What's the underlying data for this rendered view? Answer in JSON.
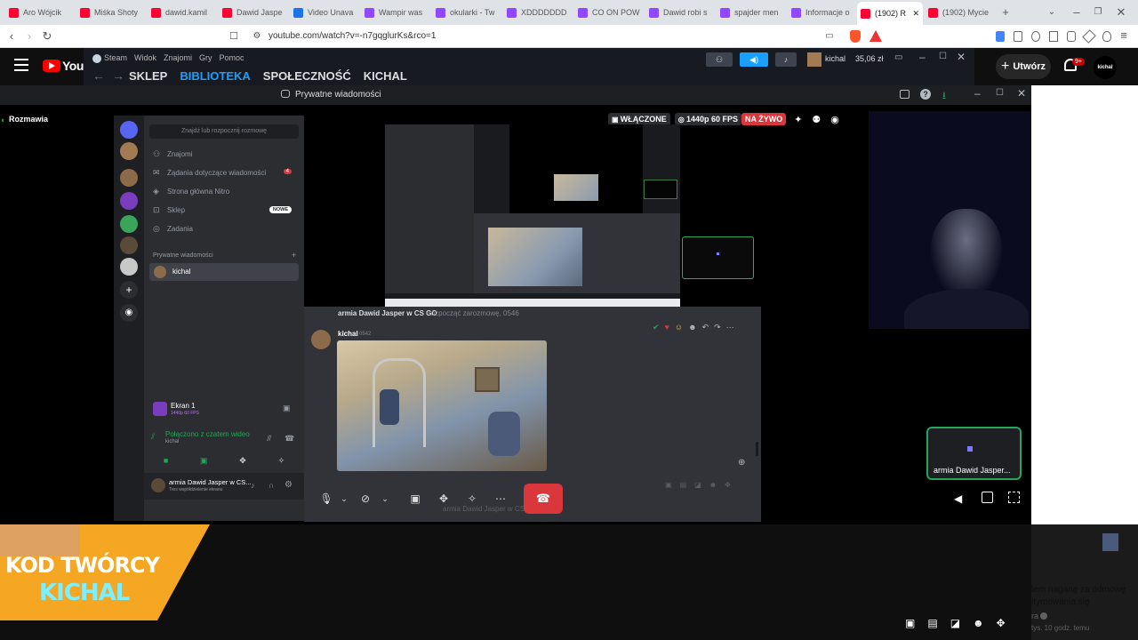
{
  "browser": {
    "tabs": [
      {
        "label": "Aro Wójcik",
        "color": "#ff0033"
      },
      {
        "label": "Miśka Shoty",
        "color": "#ff0033"
      },
      {
        "label": "dawid.kamil",
        "color": "#ff0033"
      },
      {
        "label": "Dawid Jaspe",
        "color": "#ff0033"
      },
      {
        "label": "Video Unava",
        "color": "#1a73e8"
      },
      {
        "label": "Wampir was",
        "color": "#9146ff"
      },
      {
        "label": "okularki - Tw",
        "color": "#9146ff"
      },
      {
        "label": "XDDDDDDD",
        "color": "#9146ff"
      },
      {
        "label": "CO ON POW",
        "color": "#9146ff"
      },
      {
        "label": "Dawid robi s",
        "color": "#9146ff"
      },
      {
        "label": "spajder men",
        "color": "#9146ff"
      },
      {
        "label": "Informacje o",
        "color": "#9146ff"
      },
      {
        "label": "(1902) R",
        "color": "#ff0033"
      },
      {
        "label": "(1902) Mycie",
        "color": "#ff0033"
      }
    ],
    "url": "youtube.com/watch?v=-n7gqglurKs&rco=1"
  },
  "youtube": {
    "logo": "YouTu",
    "create_label": "Utwórz",
    "notif_badge": "9+",
    "avatar_label": "kichal"
  },
  "steam": {
    "menu": [
      "Steam",
      "Widok",
      "Znajomi",
      "Gry",
      "Pomoc"
    ],
    "nav": [
      "SKLEP",
      "BIBLIOTEKA",
      "SPOŁECZNOŚĆ",
      "KICHAL"
    ],
    "active_nav": "BIBLIOTEKA",
    "user": "kichal",
    "balance": "35,06 zł"
  },
  "discord": {
    "title": "Prywatne wiadomości",
    "call_label": "Rozmawia",
    "stream_badges": {
      "on": "WŁĄCZONE",
      "quality": "1440p 60 FPS",
      "live": "NA ŻYWO"
    },
    "search_placeholder": "Znajdź lub rozpocznij rozmowę",
    "menu": [
      {
        "label": "Znajomi"
      },
      {
        "label": "Żądania dotyczące wiadomości",
        "badge": "4"
      },
      {
        "label": "Strona główna Nitro"
      },
      {
        "label": "Sklep",
        "badge": "NOWE"
      },
      {
        "label": "Zadania"
      }
    ],
    "dm_header": "Prywatne wiadomości",
    "dm_user": "kichal",
    "screen_share": {
      "title": "Ekran 1",
      "sub": "1440p 60 FPS"
    },
    "voice_status": "Połączono z czatem wideo",
    "voice_user": "kichal",
    "bottom_user": "armia Dawid Jasper w CS...",
    "bottom_user_sub": "Tres współdzielenie ekranu",
    "chat_header": "armia Dawid Jasper w CS GO",
    "chat_header_suffix": "rozpocząć zarozmowę, 0546",
    "message_author": "kichal",
    "message_time": "0542",
    "input_placeholder": "armia Dawid Jasper w CS GO",
    "tile_label": "armia Dawid Jasper..."
  },
  "overlay": {
    "line1": "KOD TWÓRCY",
    "line2": "KICHAL"
  },
  "comments": {
    "line1": "lem naganę za odmowę",
    "line2": "itymowania się",
    "author": "ra",
    "meta": "tys.  10 godz. temu"
  }
}
